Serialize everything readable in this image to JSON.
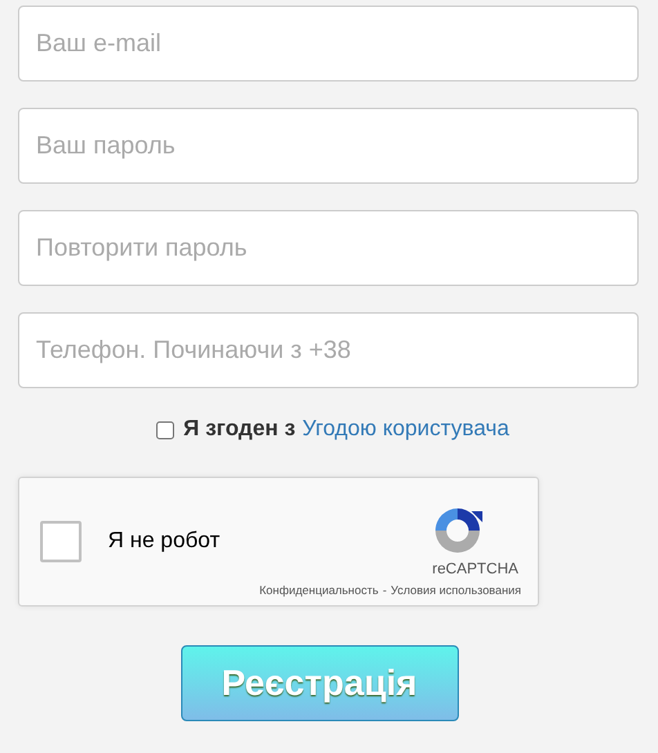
{
  "fields": [
    {
      "placeholder": "Ваш e-mail"
    },
    {
      "placeholder": "Ваш пароль"
    },
    {
      "placeholder": "Повторити пароль"
    },
    {
      "placeholder": "Телефон. Починаючи з +38"
    }
  ],
  "agreement": {
    "checked": false,
    "label": "Я згоден з",
    "link": "Угодою користувача"
  },
  "captcha": {
    "checked": false,
    "label": "Я не робот",
    "brand": "reCAPTCHA",
    "privacy": "Конфиденциальность",
    "separator": "-",
    "terms": "Условия использования"
  },
  "submit": "Реєстрація"
}
